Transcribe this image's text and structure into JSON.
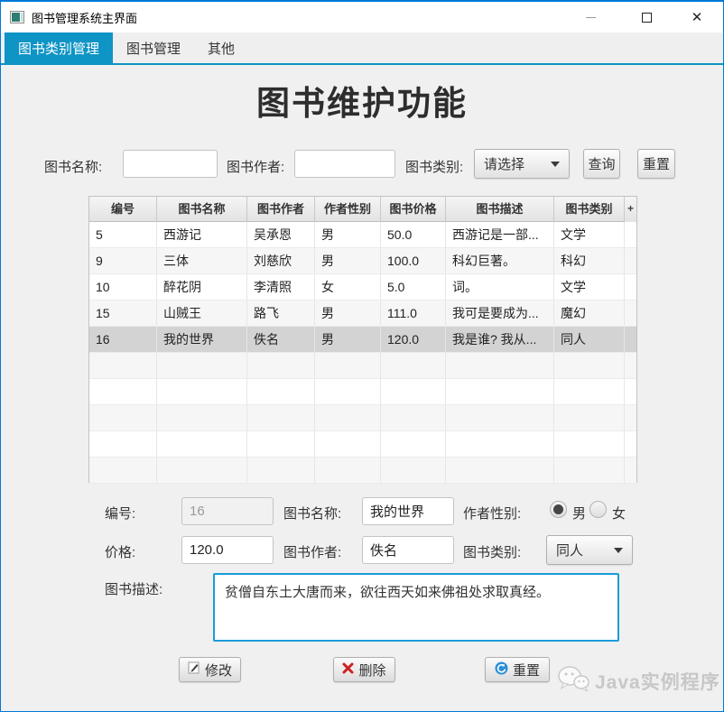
{
  "window": {
    "title": "图书管理系统主界面",
    "controls": {
      "minimize": "minimize",
      "maximize": "maximize",
      "close": "✕"
    }
  },
  "tabs": [
    {
      "label": "图书类别管理",
      "active": true
    },
    {
      "label": "图书管理",
      "active": false
    },
    {
      "label": "其他",
      "active": false
    }
  ],
  "page_title": "图书维护功能",
  "search": {
    "name_label": "图书名称:",
    "name_value": "",
    "author_label": "图书作者:",
    "author_value": "",
    "category_label": "图书类别:",
    "category_value": "请选择",
    "query_button": "查询",
    "reset_button": "重置"
  },
  "table": {
    "columns": [
      "编号",
      "图书名称",
      "图书作者",
      "作者性别",
      "图书价格",
      "图书描述",
      "图书类别"
    ],
    "corner_button": "+",
    "rows": [
      [
        "5",
        "西游记",
        "吴承恩",
        "男",
        "50.0",
        "西游记是一部...",
        "文学"
      ],
      [
        "9",
        "三体",
        "刘慈欣",
        "男",
        "100.0",
        "科幻巨著。",
        "科幻"
      ],
      [
        "10",
        "醉花阴",
        "李清照",
        "女",
        "5.0",
        "词。",
        "文学"
      ],
      [
        "15",
        "山贼王",
        "路飞",
        "男",
        "111.0",
        "我可是要成为...",
        "魔幻"
      ],
      [
        "16",
        "我的世界",
        "佚名",
        "男",
        "120.0",
        "我是谁? 我从...",
        "同人"
      ]
    ],
    "selected_row_index": 4
  },
  "form": {
    "id_label": "编号:",
    "id_value": "16",
    "name_label": "图书名称:",
    "name_value": "我的世界",
    "gender_label": "作者性别:",
    "gender_male": "男",
    "gender_female": "女",
    "gender_selected": "男",
    "price_label": "价格:",
    "price_value": "120.0",
    "author_label": "图书作者:",
    "author_value": "佚名",
    "category_label": "图书类别:",
    "category_value": "同人",
    "desc_label": "图书描述:",
    "desc_value": "贫僧自东土大唐而来，欲往西天如来佛祖处求取真经。"
  },
  "actions": {
    "edit": "修改",
    "delete": "删除",
    "reset": "重置"
  },
  "watermark": "Java实例程序",
  "colors": {
    "accent_blue": "#0e94c5",
    "window_border": "#0078d7",
    "delete_red": "#cc2222",
    "reset_icon_blue": "#2b8fd8",
    "selected_row": "#d3d3d3"
  }
}
